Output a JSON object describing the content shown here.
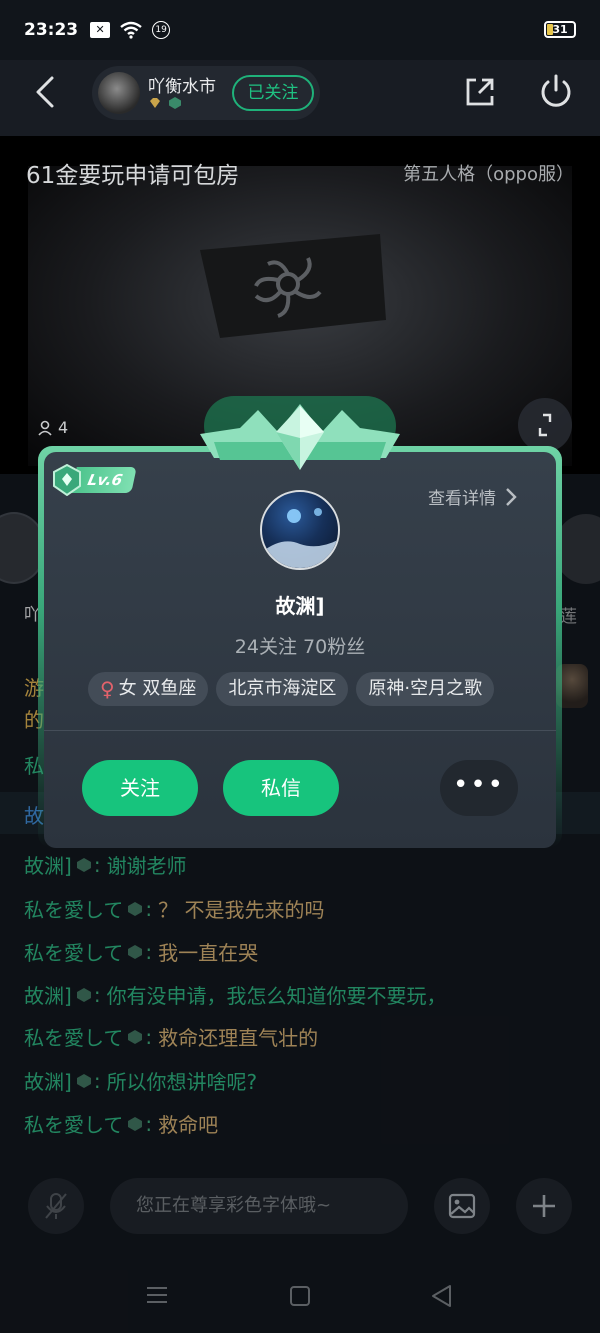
{
  "status_bar": {
    "time": "23:23",
    "notif_count": "19",
    "battery": "31"
  },
  "header": {
    "host_name": "吖衡水市",
    "follow_label": "已关注"
  },
  "room": {
    "title": "61金要玩申请可包房",
    "game": "第五人格（oppo服）",
    "viewers": "4"
  },
  "seats": {
    "left_label": "吖",
    "right_label": "莲"
  },
  "profile_card": {
    "level": "Lv.6",
    "detail_link": "查看详情",
    "name": "故渊]",
    "stats": "24关注 70粉丝",
    "tags": [
      "女 双鱼座",
      "北京市海淀区",
      "原神·空月之歌"
    ],
    "follow_button": "关注",
    "message_button": "私信",
    "more_button": "•••"
  },
  "chat": {
    "peek_1": "游",
    "peek_2": "的",
    "peek_3": "私",
    "peek_4": "故",
    "messages": [
      {
        "user": "故渊]",
        "text": "谢谢老师"
      },
      {
        "user": "私を愛して",
        "text": "？ 不是我先来的吗"
      },
      {
        "user": "私を愛して",
        "text": "我一直在哭"
      },
      {
        "user": "故渊]",
        "text": "你有没申请，我怎么知道你要不要玩，"
      },
      {
        "user": "私を愛して",
        "text": "救命还理直气壮的"
      },
      {
        "user": "故渊]",
        "text": "所以你想讲啥呢?"
      },
      {
        "user": "私を愛して",
        "text": "救命吧"
      }
    ]
  },
  "input": {
    "placeholder": "您正在尊享彩色字体哦~"
  },
  "colors": {
    "accent_green": "#17c47d",
    "chat_teal": "#2aa476",
    "chat_tan": "#c1a069"
  }
}
